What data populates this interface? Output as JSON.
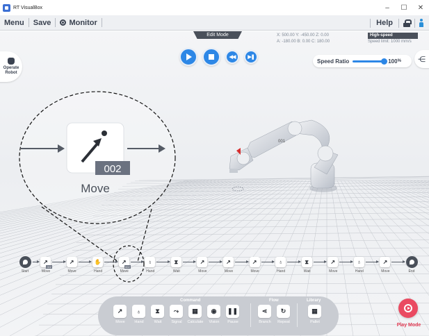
{
  "window": {
    "title": "RT VisualBox",
    "controls": [
      "–",
      "☐",
      "✕"
    ]
  },
  "menu": {
    "menu_label": "Menu",
    "save_label": "Save",
    "monitor_label": "Monitor",
    "help_label": "Help"
  },
  "viewport": {
    "mode_label": "Edit Mode",
    "coords": {
      "line1": "X:   500.00 Y:  -450.00 Z:     0.00",
      "line2": "A:  -180.00 B:      0.00 C:  180.00"
    },
    "speed_mode": "High-speed",
    "speed_limit_label": "Speed limit:",
    "speed_limit_value": "1000 mm/s",
    "speed_ratio_label": "Speed Ratio",
    "speed_ratio_value": "100",
    "speed_ratio_unit": "%",
    "speed_ratio_fraction": 1.0,
    "operate_robot_label": "Operate Robot",
    "robot_tag": "001"
  },
  "magnifier": {
    "block_label": "Move",
    "block_number": "002"
  },
  "flow": {
    "start_label": "Start",
    "end_label": "End",
    "blocks": [
      {
        "label": "Move",
        "glyph": "↗",
        "tag": "002"
      },
      {
        "label": "Move",
        "glyph": "↗",
        "tag": ""
      },
      {
        "label": "Hand",
        "glyph": "✋",
        "tag": ""
      },
      {
        "label": "Move",
        "glyph": "↗",
        "tag": "002"
      },
      {
        "label": "Hand",
        "glyph": "♁",
        "tag": ""
      },
      {
        "label": "Wait",
        "glyph": "⧗",
        "tag": ""
      },
      {
        "label": "Move",
        "glyph": "↗",
        "tag": ""
      },
      {
        "label": "Move",
        "glyph": "↗",
        "tag": ""
      },
      {
        "label": "Move",
        "glyph": "↗",
        "tag": ""
      },
      {
        "label": "Hand",
        "glyph": "♁",
        "tag": ""
      },
      {
        "label": "Wait",
        "glyph": "⧗",
        "tag": ""
      },
      {
        "label": "Move",
        "glyph": "↗",
        "tag": ""
      },
      {
        "label": "Hand",
        "glyph": "♁",
        "tag": ""
      },
      {
        "label": "Move",
        "glyph": "↗",
        "tag": ""
      }
    ]
  },
  "palette": {
    "groups": {
      "command": "Command",
      "flow": "Flow",
      "library": "Library"
    },
    "command_items": [
      {
        "label": "Move",
        "glyph": "↗"
      },
      {
        "label": "Hand",
        "glyph": "♁"
      },
      {
        "label": "Wait",
        "glyph": "⧗"
      },
      {
        "label": "Signal",
        "glyph": "⤳"
      },
      {
        "label": "Calculate",
        "glyph": "▦"
      },
      {
        "label": "Vision",
        "glyph": "◉"
      },
      {
        "label": "Pause",
        "glyph": "❚❚"
      }
    ],
    "flow_items": [
      {
        "label": "Branch",
        "glyph": "⋖"
      },
      {
        "label": "Repeat",
        "glyph": "↻"
      }
    ],
    "library_items": [
      {
        "label": "Pallet",
        "glyph": "▦"
      }
    ]
  },
  "play_mode_label": "Play Mode",
  "colors": {
    "accent": "#2d87e6",
    "play_mode": "#ea4a61",
    "dark": "#4a505a"
  }
}
